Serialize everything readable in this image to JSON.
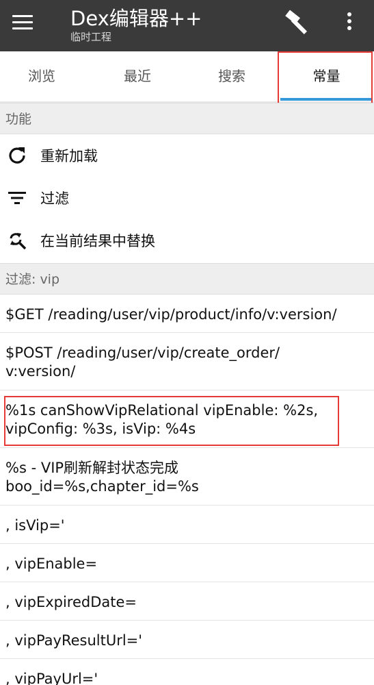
{
  "appbar": {
    "title": "Dex编辑器++",
    "subtitle": "临时工程",
    "menu_icon": "hamburger-menu-icon",
    "build_icon": "hammer-icon",
    "more_icon": "more-vert-icon"
  },
  "tabs": [
    {
      "label": "浏览",
      "active": false
    },
    {
      "label": "最近",
      "active": false
    },
    {
      "label": "搜索",
      "active": false
    },
    {
      "label": "常量",
      "active": true
    }
  ],
  "functions": {
    "header": "功能",
    "actions": [
      {
        "label": "重新加载",
        "icon": "refresh-icon"
      },
      {
        "label": "过滤",
        "icon": "filter-icon"
      },
      {
        "label": "在当前结果中替换",
        "icon": "find-replace-icon"
      }
    ]
  },
  "filter": {
    "header": "过滤: vip"
  },
  "constants": [
    "$GET /reading/user/vip/product/info/v:version/",
    "$POST /reading/user/vip/create_order/\nv:version/",
    "%1s canShowVipRelational vipEnable: %2s,\nvipConfig: %3s, isVip: %4s",
    "%s - VIP刷新解封状态完成\nboo_id=%s,chapter_id=%s",
    ", isVip='",
    ", vipEnable=",
    ", vipExpiredDate=",
    ", vipPayResultUrl='",
    ", vipPayUrl='"
  ],
  "colors": {
    "appbar_bg": "#3a3a3a",
    "tab_indicator": "#3498db",
    "highlight": "#e53935",
    "section_bg": "#eeeeee"
  }
}
